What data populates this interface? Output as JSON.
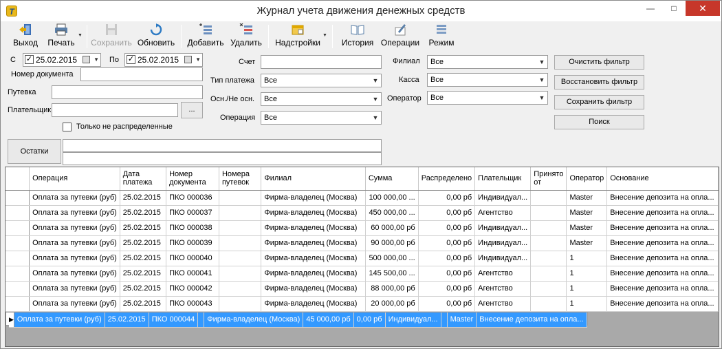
{
  "window": {
    "title": "Журнал учета движения денежных средств",
    "icon_letter": "T"
  },
  "toolbar": {
    "exit": "Выход",
    "print": "Печать",
    "save": "Сохранить",
    "refresh": "Обновить",
    "add": "Добавить",
    "delete": "Удалить",
    "settings": "Надстройки",
    "history": "История",
    "operations": "Операции",
    "mode": "Режим"
  },
  "filters": {
    "from_label": "С",
    "from_date": "25.02.2015",
    "to_label": "По",
    "to_date": "25.02.2015",
    "doc_number_label": "Номер документа",
    "voucher_label": "Путевка",
    "payer_label": "Плательщик",
    "payer_browse": "...",
    "only_unallocated": "Только не распределенные",
    "account_label": "Счет",
    "payment_type_label": "Тип платежа",
    "payment_type_value": "Все",
    "main_label": "Осн./Не осн.",
    "main_value": "Все",
    "operation_label": "Операция",
    "operation_value": "Все",
    "branch_label": "Филиал",
    "branch_value": "Все",
    "cashbox_label": "Касса",
    "cashbox_value": "Все",
    "operator_label": "Оператор",
    "operator_value": "Все",
    "clear": "Очистить фильтр",
    "restore": "Восстановить фильтр",
    "save": "Сохранить фильтр",
    "search": "Поиск",
    "balances": "Остатки"
  },
  "grid": {
    "columns": [
      "Операция",
      "Дата платежа",
      "Номер документа",
      "Номера путевок",
      "Филиал",
      "Сумма",
      "Распределено",
      "Плательщик",
      "Принято от",
      "Оператор",
      "Основание"
    ],
    "rows": [
      [
        "Оплата за путевки (руб)",
        "25.02.2015",
        "ПКО 000036",
        "",
        "Фирма-владелец (Москва)",
        "100 000,00 ...",
        "0,00 рб",
        "Индивидуал...",
        "",
        "Master",
        "Внесение депозита на опла..."
      ],
      [
        "Оплата за путевки (руб)",
        "25.02.2015",
        "ПКО 000037",
        "",
        "Фирма-владелец (Москва)",
        "450 000,00 ...",
        "0,00 рб",
        "Агентство",
        "",
        "Master",
        "Внесение депозита на опла..."
      ],
      [
        "Оплата за путевки (руб)",
        "25.02.2015",
        "ПКО 000038",
        "",
        "Фирма-владелец (Москва)",
        "60 000,00 рб",
        "0,00 рб",
        "Индивидуал...",
        "",
        "Master",
        "Внесение депозита на опла..."
      ],
      [
        "Оплата за путевки (руб)",
        "25.02.2015",
        "ПКО 000039",
        "",
        "Фирма-владелец (Москва)",
        "90 000,00 рб",
        "0,00 рб",
        "Индивидуал...",
        "",
        "Master",
        "Внесение депозита на опла..."
      ],
      [
        "Оплата за путевки (руб)",
        "25.02.2015",
        "ПКО 000040",
        "",
        "Фирма-владелец (Москва)",
        "500 000,00 ...",
        "0,00 рб",
        "Индивидуал...",
        "",
        "1",
        "Внесение депозита на опла..."
      ],
      [
        "Оплата за путевки (руб)",
        "25.02.2015",
        "ПКО 000041",
        "",
        "Фирма-владелец (Москва)",
        "145 500,00 ...",
        "0,00 рб",
        "Агентство",
        "",
        "1",
        "Внесение депозита на опла..."
      ],
      [
        "Оплата за путевки (руб)",
        "25.02.2015",
        "ПКО 000042",
        "",
        "Фирма-владелец (Москва)",
        "88 000,00 рб",
        "0,00 рб",
        "Агентство",
        "",
        "1",
        "Внесение депозита на опла..."
      ],
      [
        "Оплата за путевки (руб)",
        "25.02.2015",
        "ПКО 000043",
        "",
        "Фирма-владелец (Москва)",
        "20 000,00 рб",
        "0,00 рб",
        "Агентство",
        "",
        "1",
        "Внесение депозита на опла..."
      ],
      [
        "Оплата за путевки (руб)",
        "25.02.2015",
        "ПКО 000044",
        "",
        "Фирма-владелец (Москва)",
        "45 000,00 рб",
        "0,00 рб",
        "Индивидуал...",
        "",
        "Master",
        "Внесение депозита на опла..."
      ]
    ],
    "selected_index": 8
  }
}
